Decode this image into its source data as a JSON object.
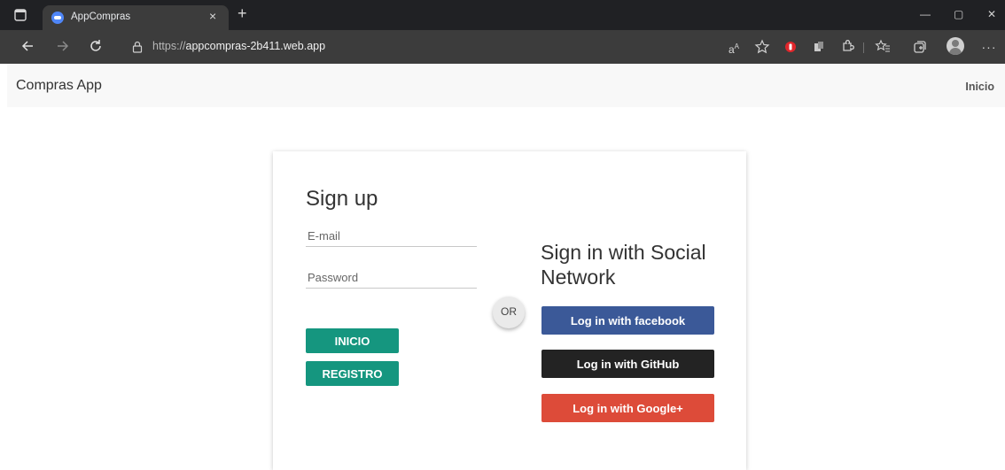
{
  "browser": {
    "tab_title": "AppCompras",
    "url_prefix": "https://",
    "url_host": "appcompras-2b411.web.app",
    "tab_close": "×",
    "new_tab": "+",
    "window_controls": [
      "—",
      "▢",
      "✕"
    ],
    "nav_icons": [
      "back-icon",
      "forward-icon",
      "refresh-icon",
      "lock-icon"
    ],
    "toolbar_icons": [
      "read-aloud-icon",
      "add-favorite-icon",
      "adblock-icon",
      "extension-icon",
      "extensions-icon",
      "favorites-icon",
      "collections-icon",
      "profile-icon",
      "more-icon"
    ]
  },
  "navbar": {
    "brand": "Compras App",
    "link": "Inicio"
  },
  "signup": {
    "title": "Sign up",
    "email_placeholder": "E-mail",
    "password_placeholder": "Password",
    "login_button": "INICIO",
    "register_button": "REGISTRO"
  },
  "divider": {
    "label": "OR"
  },
  "social": {
    "title": "Sign in with Social Network",
    "facebook": "Log in with facebook",
    "github": "Log in with GitHub",
    "google": "Log in with Google+"
  },
  "colors": {
    "teal": "#15967f",
    "facebook": "#3b5998",
    "github": "#232323",
    "google": "#dd4b39"
  }
}
